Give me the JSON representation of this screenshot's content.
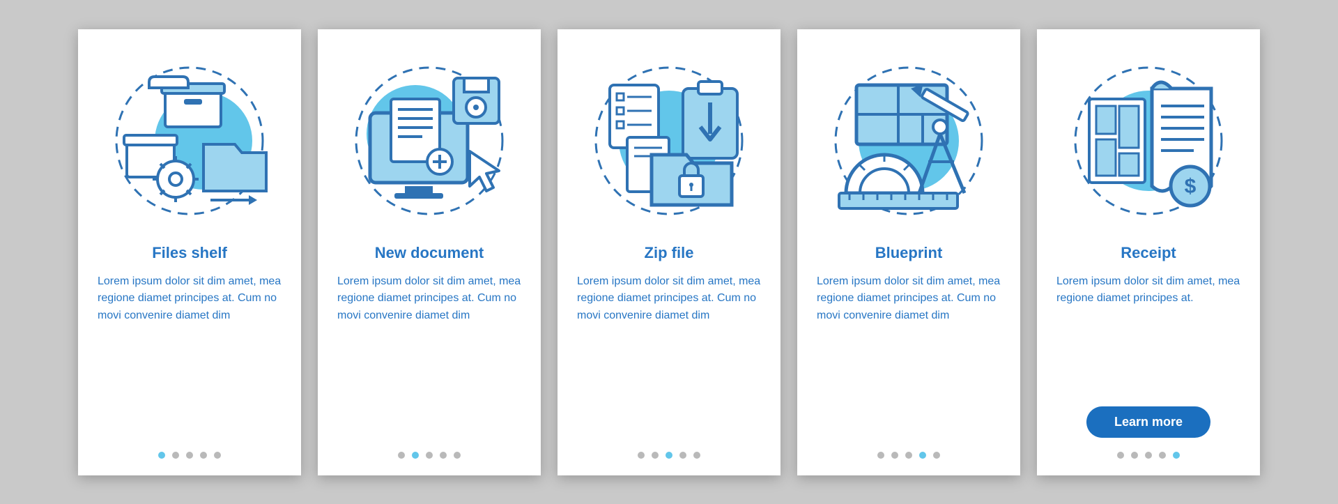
{
  "colors": {
    "stroke": "#2f72b3",
    "fillLight": "#9dd5ef",
    "fillMid": "#5fbfe6",
    "accentBg": "#62c6ea",
    "white": "#ffffff"
  },
  "cards": [
    {
      "title": "Files shelf",
      "body": "Lorem ipsum dolor sit dim amet, mea regione diamet principes at. Cum no movi convenire diamet dim",
      "activeDot": 0,
      "cta": null
    },
    {
      "title": "New document",
      "body": "Lorem ipsum dolor sit dim amet, mea regione diamet principes at. Cum no movi convenire diamet dim",
      "activeDot": 1,
      "cta": null
    },
    {
      "title": "Zip file",
      "body": "Lorem ipsum dolor sit dim amet, mea regione diamet principes at. Cum no movi convenire diamet dim",
      "activeDot": 2,
      "cta": null
    },
    {
      "title": "Blueprint",
      "body": "Lorem ipsum dolor sit dim amet, mea regione diamet principes at. Cum no movi convenire diamet dim",
      "activeDot": 3,
      "cta": null
    },
    {
      "title": "Receipt",
      "body": "Lorem ipsum dolor sit dim amet, mea regione diamet principes at.",
      "activeDot": 4,
      "cta": "Learn more"
    }
  ],
  "dotCount": 5
}
